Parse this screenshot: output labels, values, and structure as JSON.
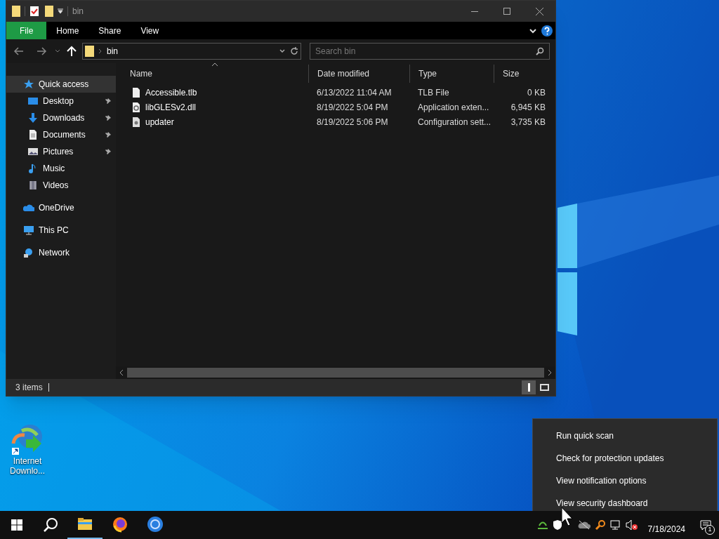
{
  "window": {
    "title": "bin"
  },
  "ribbon_tabs": [
    {
      "label": "File",
      "kind": "file"
    },
    {
      "label": "Home",
      "kind": "tab"
    },
    {
      "label": "Share",
      "kind": "tab"
    },
    {
      "label": "View",
      "kind": "tab"
    }
  ],
  "address": {
    "path": "bin"
  },
  "search": {
    "placeholder": "Search bin"
  },
  "sidebar": {
    "items": [
      {
        "label": "Quick access",
        "selected": true,
        "children": [
          {
            "label": "Desktop",
            "pinned": true,
            "selected": false
          },
          {
            "label": "Downloads",
            "pinned": true,
            "selected": false
          },
          {
            "label": "Documents",
            "pinned": true,
            "selected": false
          },
          {
            "label": "Pictures",
            "pinned": true,
            "selected": false
          },
          {
            "label": "Music",
            "pinned": false,
            "selected": false
          },
          {
            "label": "Videos",
            "pinned": false,
            "selected": false
          }
        ]
      },
      {
        "label": "OneDrive",
        "selected": false
      },
      {
        "label": "This PC",
        "selected": false
      },
      {
        "label": "Network",
        "selected": false
      }
    ]
  },
  "table": {
    "columns": [
      {
        "label": "Name",
        "sorted": true
      },
      {
        "label": "Date modified",
        "sorted": false
      },
      {
        "label": "Type",
        "sorted": false
      },
      {
        "label": "Size",
        "sorted": false
      }
    ],
    "rows": [
      {
        "name": "Accessible.tlb",
        "date": "6/13/2022 11:04 AM",
        "type": "TLB File",
        "size": "0 KB",
        "kind": "file"
      },
      {
        "name": "libGLESv2.dll",
        "date": "8/19/2022 5:04 PM",
        "type": "Application exten...",
        "size": "6,945 KB",
        "kind": "dll"
      },
      {
        "name": "updater",
        "date": "8/19/2022 5:06 PM",
        "type": "Configuration sett...",
        "size": "3,735 KB",
        "kind": "config"
      }
    ]
  },
  "status_bar": {
    "count": "3 items"
  },
  "desktop_icons": [
    {
      "label": "Internet Downlo..."
    }
  ],
  "context_menu": {
    "items": [
      "Run quick scan",
      "Check for protection updates",
      "View notification options",
      "View security dashboard"
    ]
  },
  "taskbar": {
    "apps": [
      {
        "kind": "explorer",
        "active": true
      },
      {
        "kind": "firefox",
        "active": false
      },
      {
        "kind": "chrome",
        "active": false
      }
    ],
    "date": "7/18/2024",
    "notifications": "1"
  }
}
